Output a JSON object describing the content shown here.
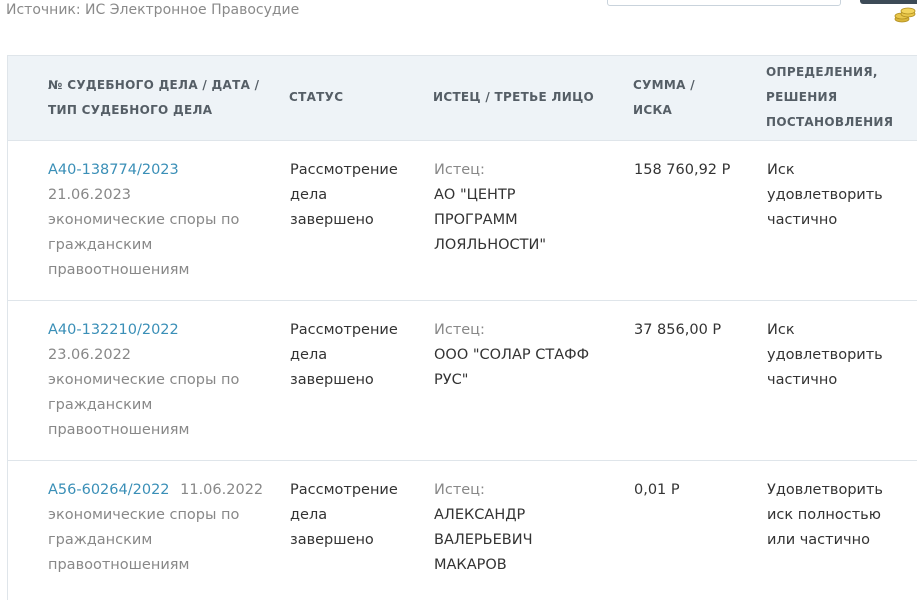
{
  "source": "Источник: ИС Электронное Правосудие",
  "table": {
    "headers": {
      "case": [
        "№ СУДЕБНОГО ДЕЛА / ДАТА /",
        "ТИП СУДЕБНОГО ДЕЛА"
      ],
      "status": [
        "СТАТУС"
      ],
      "plaintiff": [
        "ИСТЕЦ / ТРЕТЬЕ ЛИЦО"
      ],
      "amount": [
        "СУММА /",
        "ИСКА"
      ],
      "decisions": [
        "ОПРЕДЕЛЕНИЯ,",
        "РЕШЕНИЯ",
        "ПОСТАНОВЛЕНИЯ"
      ]
    },
    "rows": [
      {
        "case_number": "А40-138774/2023",
        "date": "21.06.2023",
        "case_type": [
          "экономические споры по",
          "гражданским",
          "правоотношениям"
        ],
        "status": [
          "Рассмотрение",
          "дела",
          "завершено"
        ],
        "party_role": "Истец:",
        "party_name": [
          "АО \"ЦЕНТР",
          "ПРОГРАММ",
          "ЛОЯЛЬНОСТИ\""
        ],
        "amount": "158 760,92  Р",
        "decision": [
          "Иск",
          "удовлетворить",
          "частично"
        ]
      },
      {
        "case_number": "А40-132210/2022",
        "date": "23.06.2022",
        "case_type": [
          "экономические споры по",
          "гражданским",
          "правоотношениям"
        ],
        "status": [
          "Рассмотрение",
          "дела",
          "завершено"
        ],
        "party_role": "Истец:",
        "party_name": [
          "ООО \"СОЛАР СТАФФ",
          "РУС\""
        ],
        "amount": "37 856,00  Р",
        "decision": [
          "Иск",
          "удовлетворить",
          "частично"
        ]
      },
      {
        "case_number": "А56-60264/2022",
        "date": "11.06.2022",
        "case_type": [
          "экономические споры по",
          "гражданским",
          "правоотношениям"
        ],
        "status": [
          "Рассмотрение",
          "дела",
          "завершено"
        ],
        "party_role": "Истец:",
        "party_name": [
          "АЛЕКСАНДР",
          "ВАЛЕРЬЕВИЧ",
          "МАКАРОВ"
        ],
        "amount": "0,01  Р",
        "decision": [
          "Удовлетворить",
          "иск полностью",
          "или частично"
        ]
      }
    ]
  },
  "colors": {
    "link": "#3a8fb7",
    "header_bg": "#eef3f7",
    "muted_text": "#888888",
    "border": "#dfe5ea"
  },
  "icons": [
    "coins-icon"
  ]
}
